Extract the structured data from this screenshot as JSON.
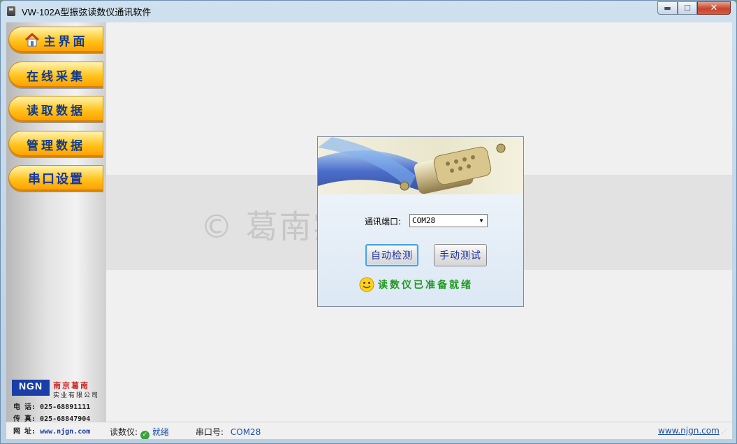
{
  "window": {
    "title": "VW-102A型振弦读数仪通讯软件",
    "min_glyph": "▬",
    "max_glyph": "☐",
    "close_glyph": "✕"
  },
  "sidebar": {
    "items": [
      {
        "label": "主界面",
        "icon": "home-icon"
      },
      {
        "label": "在线采集"
      },
      {
        "label": "读取数据"
      },
      {
        "label": "管理数据"
      },
      {
        "label": "串口设置"
      }
    ],
    "active": "串口设置",
    "logo": {
      "mark": "NGN",
      "name": "南京葛南",
      "name2": "实业有限公司"
    },
    "contact": {
      "phone": "电 话: 025-68891111",
      "fax": "传 真: 025-68847904",
      "web_label": "网 址: ",
      "web": "www.njgn.com"
    }
  },
  "watermark": "©  葛南实业 版权所有",
  "dialog": {
    "port_label": "通讯端口:",
    "port_value": "COM28",
    "auto_detect": "自动检测",
    "manual_test": "手动测试",
    "status": "读数仪已准备就绪"
  },
  "statusbar": {
    "device_label": "读数仪:",
    "device_status": "就绪",
    "port_label": "串口号:",
    "port_value": "COM28",
    "website": "www.njgn.com"
  },
  "colors": {
    "accent_blue": "#1c4fa8",
    "nav_orange": "#ffc21a",
    "ready_green": "#1f9a1f"
  }
}
